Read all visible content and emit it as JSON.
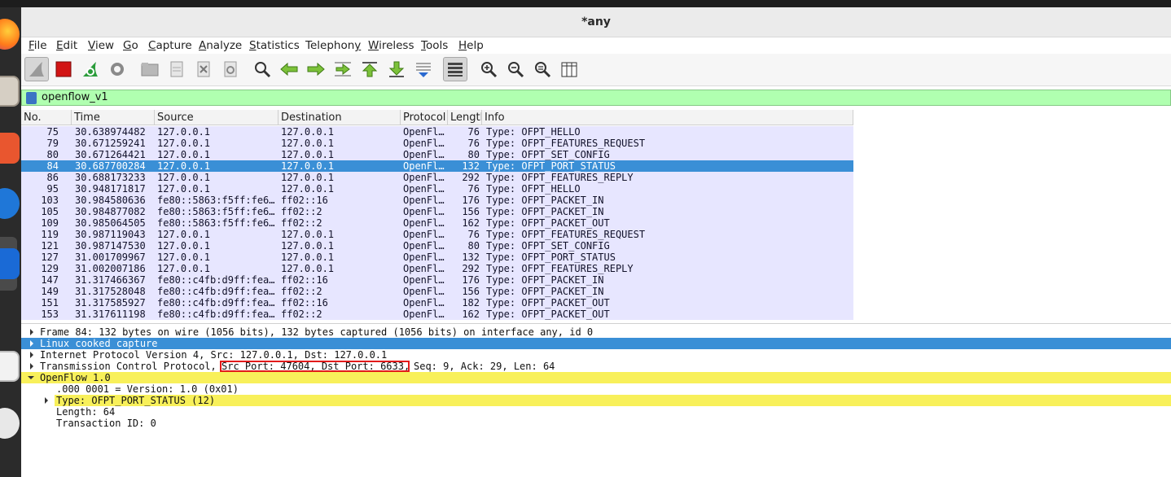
{
  "window": {
    "title": "*any"
  },
  "menu": [
    {
      "label": "File",
      "key": "F",
      "rest": "ile"
    },
    {
      "label": "Edit",
      "key": "E",
      "rest": "dit"
    },
    {
      "label": "View",
      "key": "V",
      "rest": "iew"
    },
    {
      "label": "Go",
      "key": "G",
      "rest": "o"
    },
    {
      "label": "Capture",
      "key": "C",
      "rest": "apture"
    },
    {
      "label": "Analyze",
      "key": "A",
      "rest": "nalyze"
    },
    {
      "label": "Statistics",
      "key": "S",
      "rest": "tatistics"
    },
    {
      "label": "Telephony",
      "key": "y",
      "rest": ""
    },
    {
      "label": "Wireless",
      "key": "W",
      "rest": "ireless"
    },
    {
      "label": "Tools",
      "key": "T",
      "rest": "ools"
    },
    {
      "label": "Help",
      "key": "H",
      "rest": "elp"
    }
  ],
  "toolbar": {
    "icons": [
      "shark-fin-icon",
      "stop-icon",
      "restart-capture-icon",
      "capture-options-icon",
      "open-folder-icon",
      "save-file-icon",
      "close-file-icon",
      "reload-icon",
      "find-packet-icon",
      "go-back-icon",
      "go-forward-icon",
      "go-to-packet-icon",
      "go-first-icon",
      "go-last-icon",
      "autoscroll-icon",
      "colorize-icon",
      "zoom-in-icon",
      "zoom-out-icon",
      "zoom-normal-icon",
      "resize-columns-icon"
    ]
  },
  "filter": {
    "value": "openflow_v1"
  },
  "packet_list": {
    "columns": [
      "No.",
      "Time",
      "Source",
      "Destination",
      "Protocol",
      "Length",
      "Info"
    ],
    "rows": [
      {
        "no": "75",
        "time": "30.638974482",
        "src": "127.0.0.1",
        "dst": "127.0.0.1",
        "proto": "OpenFl…",
        "len": "76",
        "info": "Type: OFPT_HELLO"
      },
      {
        "no": "79",
        "time": "30.671259241",
        "src": "127.0.0.1",
        "dst": "127.0.0.1",
        "proto": "OpenFl…",
        "len": "76",
        "info": "Type: OFPT_FEATURES_REQUEST"
      },
      {
        "no": "80",
        "time": "30.671264421",
        "src": "127.0.0.1",
        "dst": "127.0.0.1",
        "proto": "OpenFl…",
        "len": "80",
        "info": "Type: OFPT_SET_CONFIG"
      },
      {
        "no": "84",
        "time": "30.687700284",
        "src": "127.0.0.1",
        "dst": "127.0.0.1",
        "proto": "OpenFl…",
        "len": "132",
        "info": "Type: OFPT_PORT_STATUS",
        "selected": true
      },
      {
        "no": "86",
        "time": "30.688173233",
        "src": "127.0.0.1",
        "dst": "127.0.0.1",
        "proto": "OpenFl…",
        "len": "292",
        "info": "Type: OFPT_FEATURES_REPLY"
      },
      {
        "no": "95",
        "time": "30.948171817",
        "src": "127.0.0.1",
        "dst": "127.0.0.1",
        "proto": "OpenFl…",
        "len": "76",
        "info": "Type: OFPT_HELLO"
      },
      {
        "no": "103",
        "time": "30.984580636",
        "src": "fe80::5863:f5ff:fe6…",
        "dst": "ff02::16",
        "proto": "OpenFl…",
        "len": "176",
        "info": "Type: OFPT_PACKET_IN"
      },
      {
        "no": "105",
        "time": "30.984877082",
        "src": "fe80::5863:f5ff:fe6…",
        "dst": "ff02::2",
        "proto": "OpenFl…",
        "len": "156",
        "info": "Type: OFPT_PACKET_IN"
      },
      {
        "no": "109",
        "time": "30.985064505",
        "src": "fe80::5863:f5ff:fe6…",
        "dst": "ff02::2",
        "proto": "OpenFl…",
        "len": "162",
        "info": "Type: OFPT_PACKET_OUT"
      },
      {
        "no": "119",
        "time": "30.987119043",
        "src": "127.0.0.1",
        "dst": "127.0.0.1",
        "proto": "OpenFl…",
        "len": "76",
        "info": "Type: OFPT_FEATURES_REQUEST"
      },
      {
        "no": "121",
        "time": "30.987147530",
        "src": "127.0.0.1",
        "dst": "127.0.0.1",
        "proto": "OpenFl…",
        "len": "80",
        "info": "Type: OFPT_SET_CONFIG"
      },
      {
        "no": "127",
        "time": "31.001709967",
        "src": "127.0.0.1",
        "dst": "127.0.0.1",
        "proto": "OpenFl…",
        "len": "132",
        "info": "Type: OFPT_PORT_STATUS"
      },
      {
        "no": "129",
        "time": "31.002007186",
        "src": "127.0.0.1",
        "dst": "127.0.0.1",
        "proto": "OpenFl…",
        "len": "292",
        "info": "Type: OFPT_FEATURES_REPLY"
      },
      {
        "no": "147",
        "time": "31.317466367",
        "src": "fe80::c4fb:d9ff:fea…",
        "dst": "ff02::16",
        "proto": "OpenFl…",
        "len": "176",
        "info": "Type: OFPT_PACKET_IN"
      },
      {
        "no": "149",
        "time": "31.317528048",
        "src": "fe80::c4fb:d9ff:fea…",
        "dst": "ff02::2",
        "proto": "OpenFl…",
        "len": "156",
        "info": "Type: OFPT_PACKET_IN"
      },
      {
        "no": "151",
        "time": "31.317585927",
        "src": "fe80::c4fb:d9ff:fea…",
        "dst": "ff02::16",
        "proto": "OpenFl…",
        "len": "182",
        "info": "Type: OFPT_PACKET_OUT"
      },
      {
        "no": "153",
        "time": "31.317611198",
        "src": "fe80::c4fb:d9ff:fea…",
        "dst": "ff02::2",
        "proto": "OpenFl…",
        "len": "162",
        "info": "Type: OFPT_PACKET_OUT"
      }
    ]
  },
  "details": {
    "frame": "Frame 84: 132 bytes on wire (1056 bits), 132 bytes captured (1056 bits) on interface any, id 0",
    "linux": "Linux cooked capture",
    "ip": "Internet Protocol Version 4, Src: 127.0.0.1, Dst: 127.0.0.1",
    "tcp_pre": "Transmission Control Protocol,",
    "tcp_ports": "Src Port: 47604, Dst Port: 6633,",
    "tcp_post": "Seq: 9, Ack: 29, Len: 64",
    "openflow": "OpenFlow 1.0",
    "version": ".000 0001 = Version: 1.0 (0x01)",
    "type": "Type: OFPT_PORT_STATUS (12)",
    "length": "Length: 64",
    "xid": "Transaction ID: 0"
  },
  "colors": {
    "row_bg": "#e7e6ff",
    "selected": "#3a8fd6",
    "filter_ok": "#b0ffb0",
    "openflow_highlight": "#f8f05a",
    "annotation_box": "#e21b1b"
  }
}
